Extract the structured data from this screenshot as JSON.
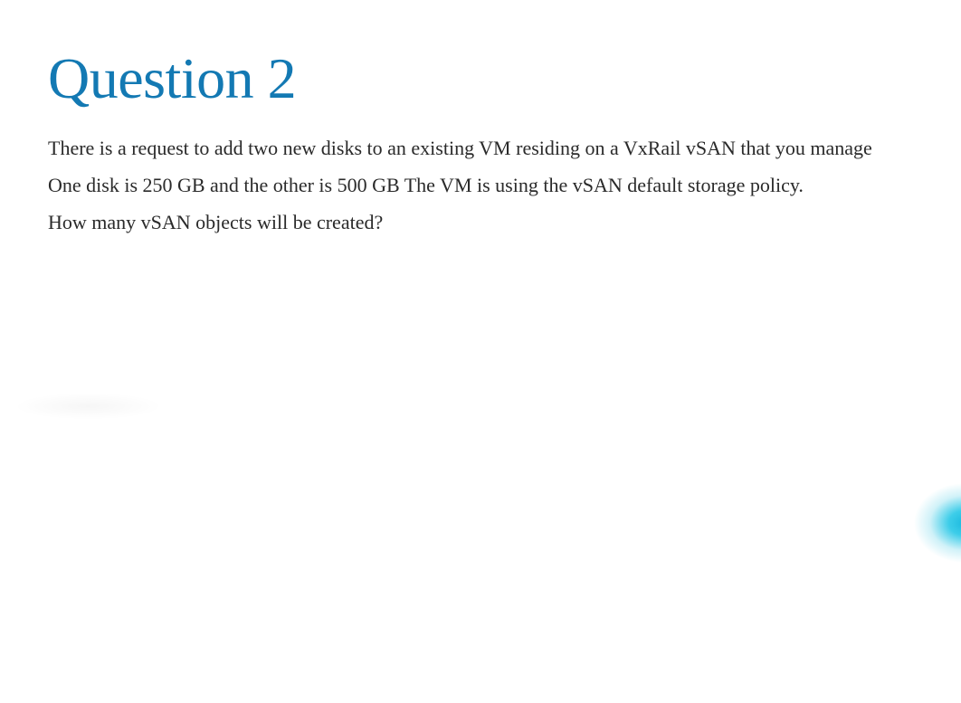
{
  "heading": "Question 2",
  "body": {
    "line1": "There is a request to add two new disks to an existing VM residing on a VxRail vSAN that you manage",
    "line2": "One disk is 250 GB and the other is 500 GB The VM is using the vSAN default storage policy.",
    "line3": "How many vSAN objects will be created?"
  }
}
